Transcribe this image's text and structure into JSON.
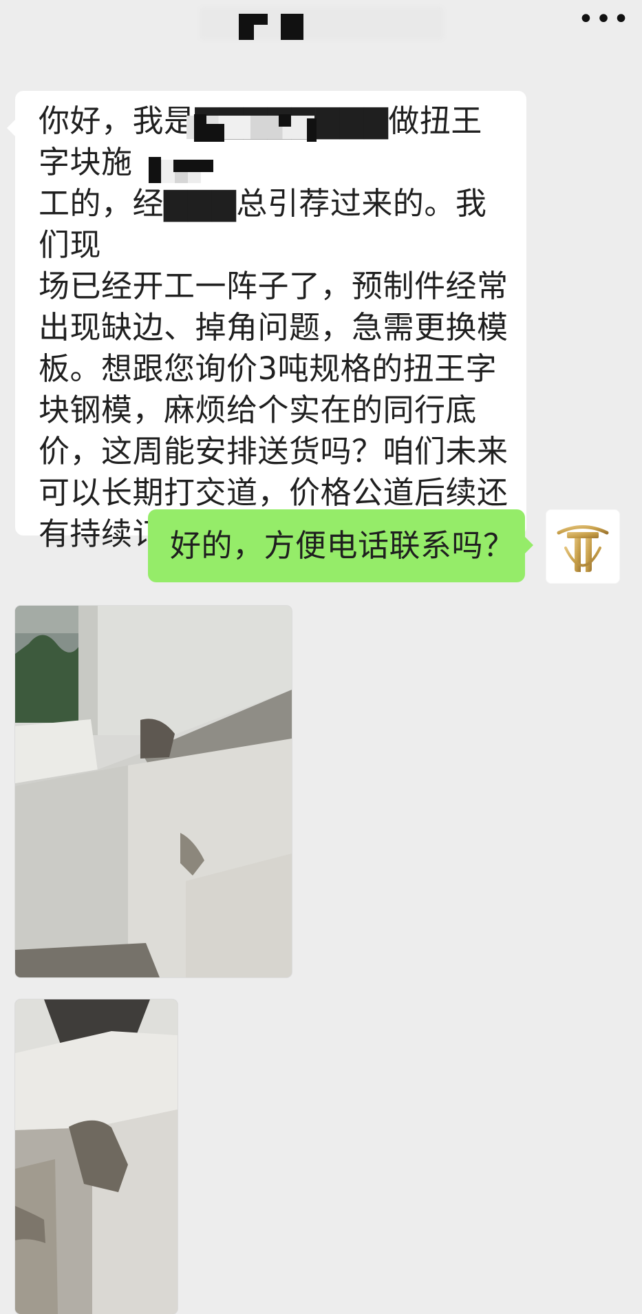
{
  "header": {
    "title": "",
    "more_label": "•••"
  },
  "messages": [
    {
      "side": "left",
      "text": "你好，我是▇▇▇▇▇▇▇▇做扭王字块施\n工的，经▇▇▇总引荐过来的。我们现\n场已经开工一阵子了，预制件经常\n出现缺边、掉角问题，急需更换模\n板。想跟您询价3吨规格的扭王字\n块钢模，麻烦给个实在的同行底\n价，这周能安排送货吗？咱们未来\n可以长期打交道，价格公道后续还\n有持续订单。"
    },
    {
      "side": "right",
      "text": "好的，方便电话联系吗？"
    }
  ],
  "images": [
    {
      "alt": "concrete block with chipped edge"
    },
    {
      "alt": "concrete block with broken corner"
    }
  ],
  "avatar": {
    "icon": "gold-monogram-logo"
  },
  "colors": {
    "background": "#ededed",
    "incoming_bubble": "#ffffff",
    "outgoing_bubble": "#95ec69",
    "text": "#1f1f1f",
    "gold": "#c8a04a"
  }
}
